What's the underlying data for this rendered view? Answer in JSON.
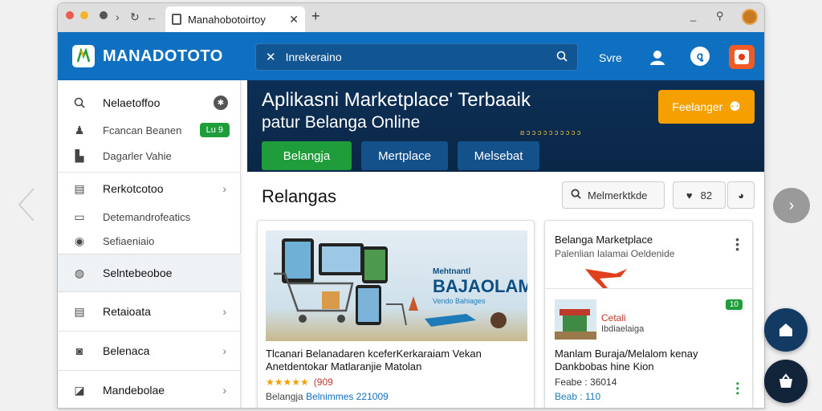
{
  "browser": {
    "tab_title": "Manahobotoirtoy",
    "close_glyph": "✕",
    "new_tab_glyph": "+"
  },
  "header": {
    "brand": "MANADOTOTO",
    "search_value": "Inrekeraino",
    "link": "Svre",
    "circle_icon_text": "ꝗ"
  },
  "sidebar": {
    "items": [
      {
        "label": "Nelaetoffoo",
        "icon": "search-icon"
      },
      {
        "label": "Fcancan Beanen",
        "badge": "Lu 9",
        "icon": "user-icon"
      },
      {
        "label": "Dagarler Vahie",
        "icon": "bookmark-icon"
      },
      {
        "label": "Rerkotcotoo",
        "icon": "calendar-icon"
      },
      {
        "label": "Detemandrofeatics",
        "icon": "wallet-icon"
      },
      {
        "label": "Sefiaeniaio",
        "icon": "eye-icon"
      },
      {
        "label": "Selntebeoboe",
        "icon": "chat-icon"
      },
      {
        "label": "Retaioata",
        "icon": "list-icon"
      },
      {
        "label": "Belenaca",
        "icon": "settings-icon"
      },
      {
        "label": "Mandebolae",
        "icon": "edit-icon"
      }
    ]
  },
  "banner": {
    "title": "Aplikasni Marketplace' Terbaaik",
    "subtitle": "patur Belanga Online",
    "small_text": "ꞛ ɔ ɔ ɔ ɔ ɔ ɔ ɔ ɔ ɔ ɔ",
    "cta_label": "Feelanger",
    "tabs": [
      "Belangja",
      "Mertplace",
      "Melsebat"
    ]
  },
  "section": {
    "title": "Relangas",
    "filter_label": "Melmerktkde",
    "chip_count": "82"
  },
  "card1": {
    "hero_top": "Mehtnantl",
    "hero_brand": "BAJAOLAM",
    "hero_sub": "Vendo Bahiages",
    "title": "Tlcanari Belanadaren kceferKerkaraiam Vekan Anetdentokar  Matlaranjie Matolan",
    "rating": "★★★★★",
    "rating_count": "(909",
    "price_prefix": "Belangja",
    "price_value": "Belnimmes 221009"
  },
  "card2": {
    "title": "Belanga Marketplace",
    "subtitle": "Palenlian Ialamai Oeldenide",
    "badge": "10",
    "thumb_title": "Cetali",
    "thumb_sub": "Ibdiaelaiga",
    "body": "Manlam Buraja/Melalom kenay Dankbobas hine Kion",
    "meta": "Feabe : 36014",
    "meta2": "Beab : 110"
  },
  "colors": {
    "header_blue": "#0f6fc0",
    "banner_navy": "#0d2f55",
    "cta_orange": "#f5a000",
    "green": "#1f9d3a",
    "tab_blue": "#14508a"
  }
}
